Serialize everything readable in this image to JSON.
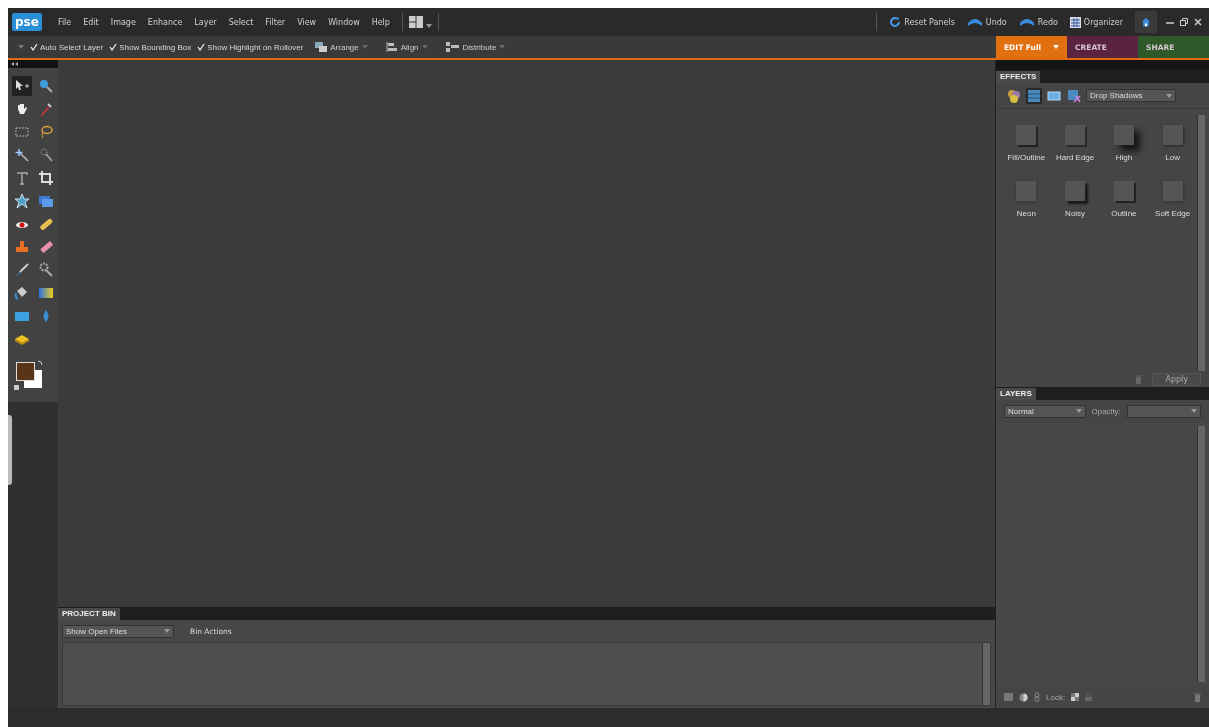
{
  "menu_bar": {
    "logo": "pse",
    "items": [
      "File",
      "Edit",
      "Image",
      "Enhance",
      "Layer",
      "Select",
      "Filter",
      "View",
      "Window",
      "Help"
    ]
  },
  "top_buttons": [
    {
      "kind": "reset",
      "label": "Reset Panels"
    },
    {
      "kind": "undo",
      "label": "Undo"
    },
    {
      "kind": "redo",
      "label": "Redo"
    },
    {
      "kind": "organizer",
      "label": "Organizer"
    }
  ],
  "options_bar": {
    "checks": [
      {
        "label": "Auto Select Layer",
        "checked": true
      },
      {
        "label": "Show Bounding Box",
        "checked": true
      },
      {
        "label": "Show Highlight on Rollover",
        "checked": true
      }
    ],
    "menus": [
      {
        "kind": "arrange",
        "label": "Arrange"
      },
      {
        "kind": "align",
        "label": "Align"
      },
      {
        "kind": "distribute",
        "label": "Distribute"
      }
    ]
  },
  "mode_tabs": [
    {
      "label": "EDIT Full",
      "selected": true,
      "color": "#e07010"
    },
    {
      "label": "CREATE",
      "selected": false,
      "color": "#5a2440"
    },
    {
      "label": "SHARE",
      "selected": false,
      "color": "#2e5a2a"
    }
  ],
  "tools": [
    {
      "kind": "move",
      "selected": true
    },
    {
      "kind": "zoom",
      "selected": false
    },
    {
      "kind": "hand",
      "selected": false
    },
    {
      "kind": "eyedropper",
      "selected": false
    },
    {
      "kind": "marquee",
      "selected": false
    },
    {
      "kind": "lasso",
      "selected": false
    },
    {
      "kind": "wand",
      "selected": false
    },
    {
      "kind": "selection-brush",
      "selected": false
    },
    {
      "kind": "type",
      "selected": false
    },
    {
      "kind": "crop",
      "selected": false
    },
    {
      "kind": "cookie",
      "selected": false
    },
    {
      "kind": "recompose",
      "selected": false
    },
    {
      "kind": "redeye",
      "selected": false
    },
    {
      "kind": "healing",
      "selected": false
    },
    {
      "kind": "stamp",
      "selected": false
    },
    {
      "kind": "eraser",
      "selected": false
    },
    {
      "kind": "brush",
      "selected": false
    },
    {
      "kind": "smart-brush",
      "selected": false
    },
    {
      "kind": "bucket",
      "selected": false
    },
    {
      "kind": "gradient",
      "selected": false
    },
    {
      "kind": "shape",
      "selected": false
    },
    {
      "kind": "blur",
      "selected": false
    },
    {
      "kind": "sponge",
      "selected": false
    }
  ],
  "effects": {
    "title": "EFFECTS",
    "icons": [
      {
        "kind": "styles",
        "selected": false
      },
      {
        "kind": "filters",
        "selected": true
      },
      {
        "kind": "photo",
        "selected": false
      },
      {
        "kind": "fx",
        "selected": false
      }
    ],
    "dropdown": "Drop Shadows",
    "items": [
      {
        "label": "Fill/Outline",
        "kind": "outline"
      },
      {
        "label": "Hard Edge",
        "kind": "hard"
      },
      {
        "label": "High",
        "kind": "high"
      },
      {
        "label": "Low",
        "kind": "low"
      },
      {
        "label": "Neon",
        "kind": "neon"
      },
      {
        "label": "Noisy",
        "kind": "noisy"
      },
      {
        "label": "Outline",
        "kind": "outline"
      },
      {
        "label": "Soft Edge",
        "kind": "soft"
      }
    ],
    "apply": "Apply"
  },
  "layers": {
    "title": "LAYERS",
    "blend_mode": "Normal",
    "opacity_label": "Opacity:",
    "lock_label": "Lock:"
  },
  "project_bin": {
    "title": "PROJECT BIN",
    "dropdown": "Show Open Files",
    "actions": "Bin Actions"
  }
}
